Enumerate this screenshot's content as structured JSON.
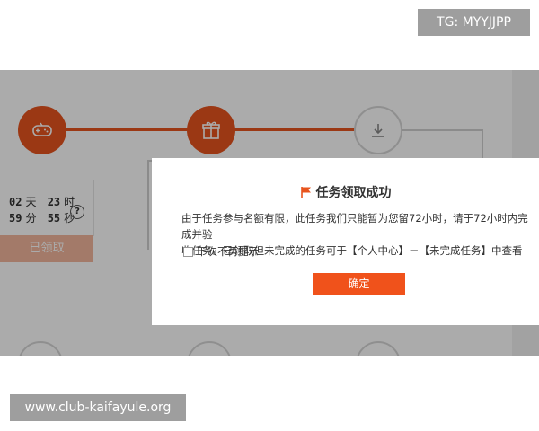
{
  "watermark": {
    "tg": "TG: MYYJJPP",
    "site": "www.club-kaifayule.org"
  },
  "countdown": {
    "days": "02",
    "days_unit": "天",
    "hours": "23",
    "hours_unit": "时",
    "minutes": "59",
    "minutes_unit": "分",
    "seconds": "55",
    "seconds_unit": "秒",
    "help": "?"
  },
  "received_button": "已领取",
  "steps": [
    {
      "icon": "gamepad-icon",
      "state": "active"
    },
    {
      "icon": "gift-icon",
      "state": "active"
    },
    {
      "icon": "download-icon",
      "state": "inactive"
    }
  ],
  "modal": {
    "icon": "flag-icon",
    "title": "任务领取成功",
    "line1": "由于任务参与名额有限，此任务我们只能暂为您留72小时，请于72小时内完成并验",
    "line2": "收任务。已领取但未完成的任务可于【个人中心】－【未完成任务】中查看",
    "checkbox_label": "下次不再提示",
    "confirm_label": "确定"
  },
  "colors": {
    "accent": "#e8541e",
    "button": "#f0521b",
    "received": "#f3b79d"
  }
}
